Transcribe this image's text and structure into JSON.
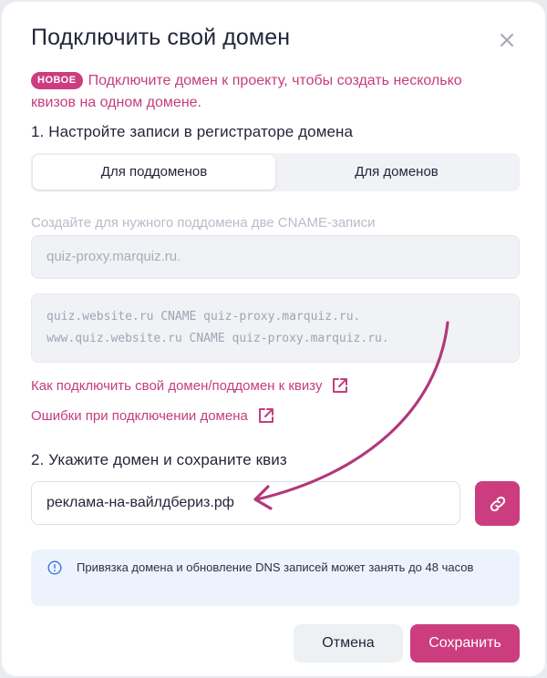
{
  "dialog": {
    "title": "Подключить свой домен",
    "badge": "НОВОЕ",
    "intro": "Подключите домен к проекту, чтобы создать несколько квизов на одном домене."
  },
  "step1": {
    "title": "1. Настройте записи в регистраторе домена",
    "tabs": [
      {
        "label": "Для поддоменов",
        "active": true
      },
      {
        "label": "Для доменов",
        "active": false
      }
    ],
    "hint": "Создайте для нужного поддомена две CNAME-записи",
    "target_value": "quiz-proxy.marquiz.ru.",
    "records": [
      "quiz.website.ru CNAME quiz-proxy.marquiz.ru.",
      "www.quiz.website.ru CNAME quiz-proxy.marquiz.ru."
    ],
    "link_howto": "Как подключить свой домен/поддомен к квизу",
    "link_errors": "Ошибки при подключении домена"
  },
  "step2": {
    "title": "2. Укажите домен и сохраните квиз",
    "domain_value": "реклама-на-вайлдбериз.рф"
  },
  "notice": {
    "text": "Привязка домена и обновление DNS записей может занять до 48 часов"
  },
  "buttons": {
    "cancel": "Отмена",
    "save": "Сохранить"
  },
  "colors": {
    "accent": "#cc3d7f",
    "notice_bg": "#edf3fd"
  }
}
